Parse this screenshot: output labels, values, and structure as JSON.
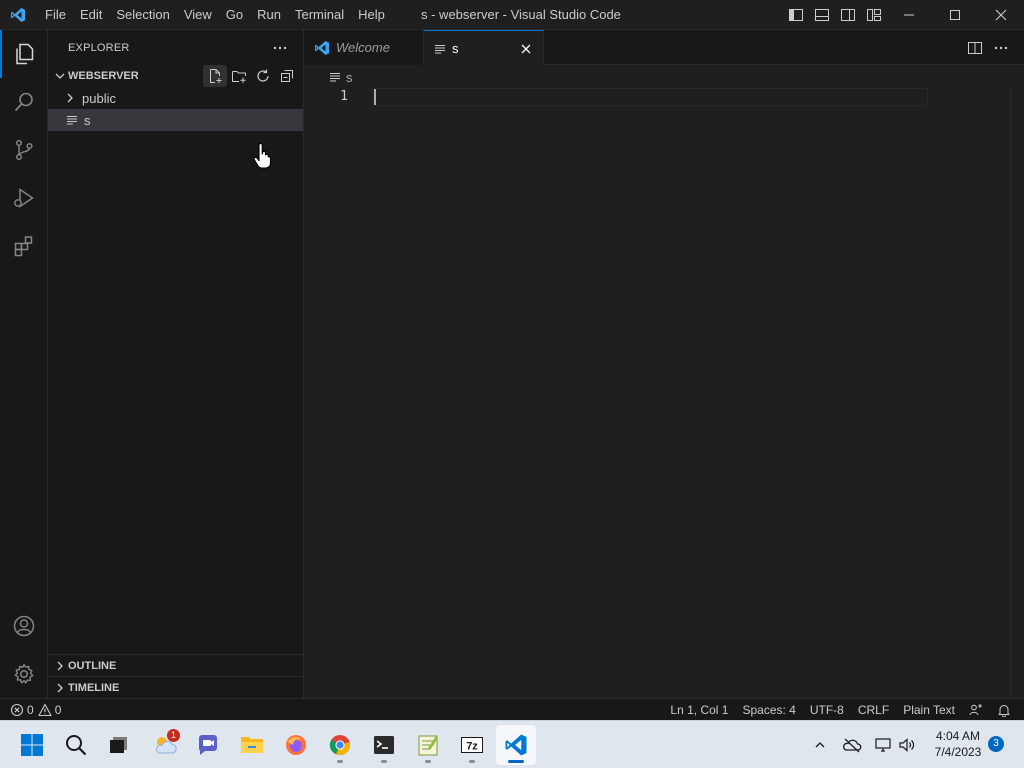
{
  "window": {
    "title": "s - webserver - Visual Studio Code",
    "menu": [
      "File",
      "Edit",
      "Selection",
      "View",
      "Go",
      "Run",
      "Terminal",
      "Help"
    ]
  },
  "activity_bar": {
    "items": [
      "explorer",
      "search",
      "source-control",
      "run-and-debug",
      "extensions"
    ],
    "bottom": [
      "accounts",
      "manage"
    ]
  },
  "sidebar": {
    "title": "EXPLORER",
    "folder": "WEBSERVER",
    "tree": [
      {
        "label": "public",
        "type": "folder",
        "expanded": false
      },
      {
        "label": "s",
        "type": "file",
        "selected": true
      }
    ],
    "sections": [
      "OUTLINE",
      "TIMELINE"
    ]
  },
  "editor": {
    "tabs": [
      {
        "label": "Welcome",
        "icon": "vscode-logo-icon",
        "active": false,
        "italic": true
      },
      {
        "label": "s",
        "icon": "file-text-icon",
        "active": true
      }
    ],
    "breadcrumb": "s",
    "lines": [
      "1"
    ]
  },
  "status_bar": {
    "errors": "0",
    "warnings": "0",
    "position": "Ln 1, Col 1",
    "spaces": "Spaces: 4",
    "encoding": "UTF-8",
    "eol": "CRLF",
    "language": "Plain Text"
  },
  "taskbar": {
    "apps": [
      "start",
      "search",
      "task-view",
      "weather",
      "teams-chat",
      "file-explorer",
      "firefox",
      "chrome",
      "terminal",
      "notepadpp",
      "7zip",
      "vscode"
    ],
    "weather_badge": "1",
    "time": "4:04 AM",
    "date": "7/4/2023",
    "notifications": "3"
  },
  "colors": {
    "accent": "#0078d4",
    "editor_bg": "#1f1f1f",
    "sidebar_bg": "#181818",
    "selection": "#37373d",
    "taskbar_bg": "#dfe6ee"
  }
}
